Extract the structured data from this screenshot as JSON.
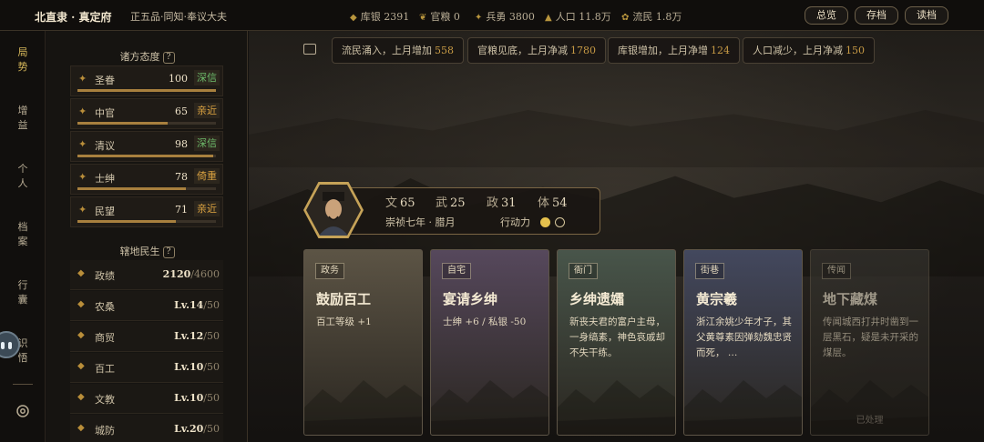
{
  "topbar": {
    "location": "北直隶 · 真定府",
    "rank": "正五品·同知·奉议大夫",
    "stats": [
      {
        "icon": "silver-icon",
        "label": "库银",
        "value": "2391"
      },
      {
        "icon": "grain-icon",
        "label": "官粮",
        "value": "0"
      },
      {
        "icon": "soldier-icon",
        "label": "兵勇",
        "value": "3800"
      },
      {
        "icon": "population-icon",
        "label": "人口",
        "value": "11.8万"
      },
      {
        "icon": "refugee-icon",
        "label": "流民",
        "value": "1.8万"
      }
    ],
    "buttons": [
      "总览",
      "存档",
      "读档"
    ]
  },
  "nav": {
    "items": [
      "局势",
      "增益",
      "个人",
      "档案",
      "行囊",
      "识悟"
    ],
    "active": "局势",
    "settings_icon": "settings-icon"
  },
  "attitudes": {
    "title": "诸方态度",
    "help": "?",
    "items": [
      {
        "icon": "imperial-icon",
        "name": "圣眷",
        "value": "100",
        "tag": "深信",
        "tag_color": "green",
        "level": 1.0
      },
      {
        "icon": "eunuch-icon",
        "name": "中官",
        "value": "65",
        "tag": "亲近",
        "tag_color": "orange",
        "level": 0.65
      },
      {
        "icon": "scholar-icon",
        "name": "清议",
        "value": "98",
        "tag": "深信",
        "tag_color": "green",
        "level": 0.98
      },
      {
        "icon": "gentry-icon",
        "name": "士绅",
        "value": "78",
        "tag": "倚重",
        "tag_color": "orange",
        "level": 0.78
      },
      {
        "icon": "people-icon",
        "name": "民望",
        "value": "71",
        "tag": "亲近",
        "tag_color": "orange",
        "level": 0.71
      }
    ]
  },
  "livelihood": {
    "title": "辖地民生",
    "help": "?",
    "items": [
      {
        "icon": "merit-icon",
        "name": "政绩",
        "value": "2120",
        "max": "/4600"
      },
      {
        "icon": "farming-icon",
        "name": "农桑",
        "value": "Lv.14",
        "max": "/50"
      },
      {
        "icon": "trade-icon",
        "name": "商贸",
        "value": "Lv.12",
        "max": "/50"
      },
      {
        "icon": "craft-icon",
        "name": "百工",
        "value": "Lv.10",
        "max": "/50"
      },
      {
        "icon": "education-icon",
        "name": "文教",
        "value": "Lv.10",
        "max": "/50"
      },
      {
        "icon": "defense-icon",
        "name": "城防",
        "value": "Lv.20",
        "max": "/50"
      }
    ]
  },
  "news": [
    {
      "text": "流民涌入，上月增加",
      "num": "558"
    },
    {
      "text": "官粮见底，上月净减",
      "num": "1780"
    },
    {
      "text": "库银增加，上月净增",
      "num": "124"
    },
    {
      "text": "人口减少，上月净减",
      "num": "150"
    }
  ],
  "character": {
    "stats": [
      {
        "label": "文",
        "value": "65"
      },
      {
        "label": "武",
        "value": "25"
      },
      {
        "label": "政",
        "value": "31"
      },
      {
        "label": "体",
        "value": "54"
      }
    ],
    "date": "崇祯七年 · 腊月",
    "ap_label": "行动力",
    "ap_current": 1,
    "ap_max": 2
  },
  "cards": [
    {
      "tag": "政务",
      "title": "鼓励百工",
      "desc": "百工等级 +1",
      "color": "#5c5445",
      "done": ""
    },
    {
      "tag": "自宅",
      "title": "宴请乡绅",
      "desc": "士绅 +6 / 私银 -50",
      "color": "#56485c",
      "done": ""
    },
    {
      "tag": "衙门",
      "title": "乡绅遗孀",
      "desc": "新丧夫君的富户主母，一身缟素，神色哀戚却不失干练。",
      "color": "#48554a",
      "done": ""
    },
    {
      "tag": "街巷",
      "title": "黄宗羲",
      "desc": "浙江余姚少年才子，其父黄尊素因弹劾魏忠贤而死， …",
      "color": "#43485e",
      "done": ""
    },
    {
      "tag": "传闻",
      "title": "地下藏煤",
      "desc": "传闻城西打井时凿到一层黑石，疑是未开采的煤层。",
      "color": "#3a3833",
      "done": "已处理"
    }
  ]
}
